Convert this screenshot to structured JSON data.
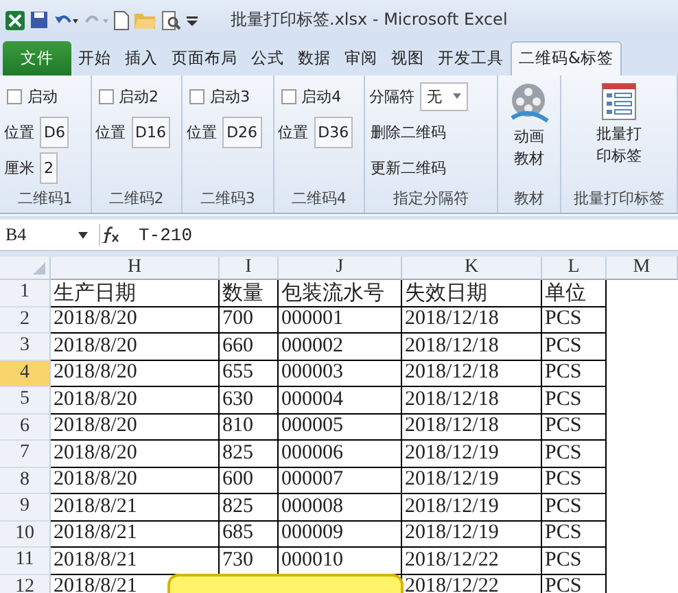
{
  "window": {
    "title": "批量打印标签.xlsx  -  Microsoft Excel"
  },
  "tabs": [
    {
      "label": "文件",
      "kind": "file",
      "selected": false
    },
    {
      "label": "开始",
      "kind": "tab",
      "selected": false
    },
    {
      "label": "插入",
      "kind": "tab",
      "selected": false
    },
    {
      "label": "页面布局",
      "kind": "tab",
      "selected": false
    },
    {
      "label": "公式",
      "kind": "tab",
      "selected": false
    },
    {
      "label": "数据",
      "kind": "tab",
      "selected": false
    },
    {
      "label": "审阅",
      "kind": "tab",
      "selected": false
    },
    {
      "label": "视图",
      "kind": "tab",
      "selected": false
    },
    {
      "label": "开发工具",
      "kind": "tab",
      "selected": false
    },
    {
      "label": "二维码&标签",
      "kind": "tab",
      "selected": true
    }
  ],
  "ribbon_groups": [
    {
      "label": "二维码1",
      "items": [
        {
          "kind": "checkbox",
          "label": "启动",
          "checked": false
        },
        {
          "kind": "field",
          "label": "位置",
          "value": "D6"
        },
        {
          "kind": "field",
          "label": "厘米",
          "value": "2"
        }
      ]
    },
    {
      "label": "二维码2",
      "items": [
        {
          "kind": "checkbox",
          "label": "启动2",
          "checked": false
        },
        {
          "kind": "field",
          "label": "位置",
          "value": "D16"
        }
      ]
    },
    {
      "label": "二维码3",
      "items": [
        {
          "kind": "checkbox",
          "label": "启动3",
          "checked": false
        },
        {
          "kind": "field",
          "label": "位置",
          "value": "D26"
        }
      ]
    },
    {
      "label": "二维码4",
      "items": [
        {
          "kind": "checkbox",
          "label": "启动4",
          "checked": false
        },
        {
          "kind": "field",
          "label": "位置",
          "value": "D36"
        }
      ]
    },
    {
      "label": "指定分隔符",
      "items": [
        {
          "kind": "dropdown",
          "label": "分隔符",
          "value": "无"
        },
        {
          "kind": "button",
          "label": "删除二维码"
        },
        {
          "kind": "button",
          "label": "更新二维码"
        }
      ]
    },
    {
      "label": "教材",
      "items": [
        {
          "kind": "reelbutton",
          "label": "动画教材"
        }
      ]
    },
    {
      "label": "批量打印标签",
      "items": [
        {
          "kind": "listbutton",
          "label": "批量打印标签"
        }
      ]
    }
  ],
  "formula_bar": {
    "name_box": "B4",
    "value": "T-210"
  },
  "sheet": {
    "columns": [
      "H",
      "I",
      "J",
      "K",
      "L",
      "M"
    ],
    "rows": [
      {
        "header": "1",
        "selected": false,
        "cells": [
          "生产日期",
          "数量",
          "包装流水号",
          "失效日期",
          "单位"
        ]
      },
      {
        "header": "2",
        "selected": false,
        "cells": [
          "2018/8/20",
          "700",
          "000001",
          "2018/12/18",
          "PCS"
        ]
      },
      {
        "header": "3",
        "selected": false,
        "cells": [
          "2018/8/20",
          "660",
          "000002",
          "2018/12/18",
          "PCS"
        ]
      },
      {
        "header": "4",
        "selected": true,
        "cells": [
          "2018/8/20",
          "655",
          "000003",
          "2018/12/18",
          "PCS"
        ]
      },
      {
        "header": "5",
        "selected": false,
        "cells": [
          "2018/8/20",
          "630",
          "000004",
          "2018/12/18",
          "PCS"
        ]
      },
      {
        "header": "6",
        "selected": false,
        "cells": [
          "2018/8/20",
          "810",
          "000005",
          "2018/12/18",
          "PCS"
        ]
      },
      {
        "header": "7",
        "selected": false,
        "cells": [
          "2018/8/20",
          "825",
          "000006",
          "2018/12/19",
          "PCS"
        ]
      },
      {
        "header": "8",
        "selected": false,
        "cells": [
          "2018/8/20",
          "600",
          "000007",
          "2018/12/19",
          "PCS"
        ]
      },
      {
        "header": "9",
        "selected": false,
        "cells": [
          "2018/8/21",
          "825",
          "000008",
          "2018/12/19",
          "PCS"
        ]
      },
      {
        "header": "10",
        "selected": false,
        "cells": [
          "2018/8/21",
          "685",
          "000009",
          "2018/12/19",
          "PCS"
        ]
      },
      {
        "header": "11",
        "selected": false,
        "cells": [
          "2018/8/21",
          "730",
          "000010",
          "2018/12/22",
          "PCS"
        ]
      },
      {
        "header": "12",
        "selected": false,
        "cells": [
          "2018/8/21",
          "",
          "",
          "2018/12/22",
          "PCS"
        ]
      }
    ]
  }
}
